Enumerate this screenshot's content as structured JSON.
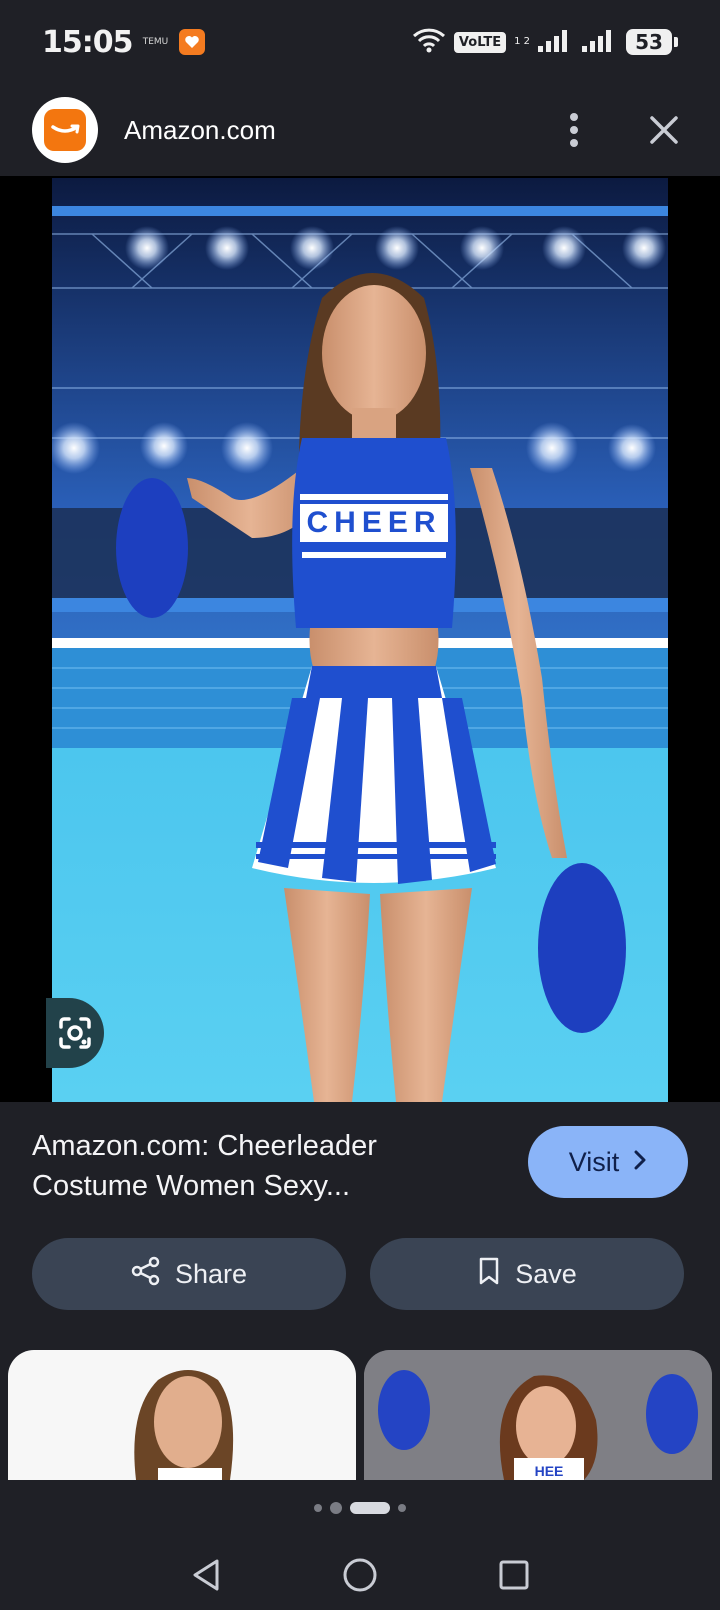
{
  "status_bar": {
    "time": "15:05",
    "temu_label": "TEMU",
    "volte": "VoLTE",
    "sim_slots": "1 2",
    "battery": "53"
  },
  "header": {
    "site_title": "Amazon.com",
    "icons": {
      "logo": "amazon-smile-logo",
      "menu": "more-vert-icon",
      "close": "close-icon"
    }
  },
  "image": {
    "shirt_text": "CHEER",
    "lens_icon": "google-lens-icon"
  },
  "result": {
    "title_line1": "Amazon.com: Cheerleader",
    "title_line2": "Costume Women Sexy...",
    "visit_label": "Visit",
    "visit_color": "#8ab4f8"
  },
  "actions": {
    "share_label": "Share",
    "save_label": "Save"
  },
  "related": {
    "card2_text": "HEE"
  },
  "pager": {
    "count": 4,
    "active": 2
  },
  "colors": {
    "background": "#1f2026",
    "pill": "#3a4454",
    "accent": "#8ab4f8",
    "brand_orange": "#f3760f"
  }
}
